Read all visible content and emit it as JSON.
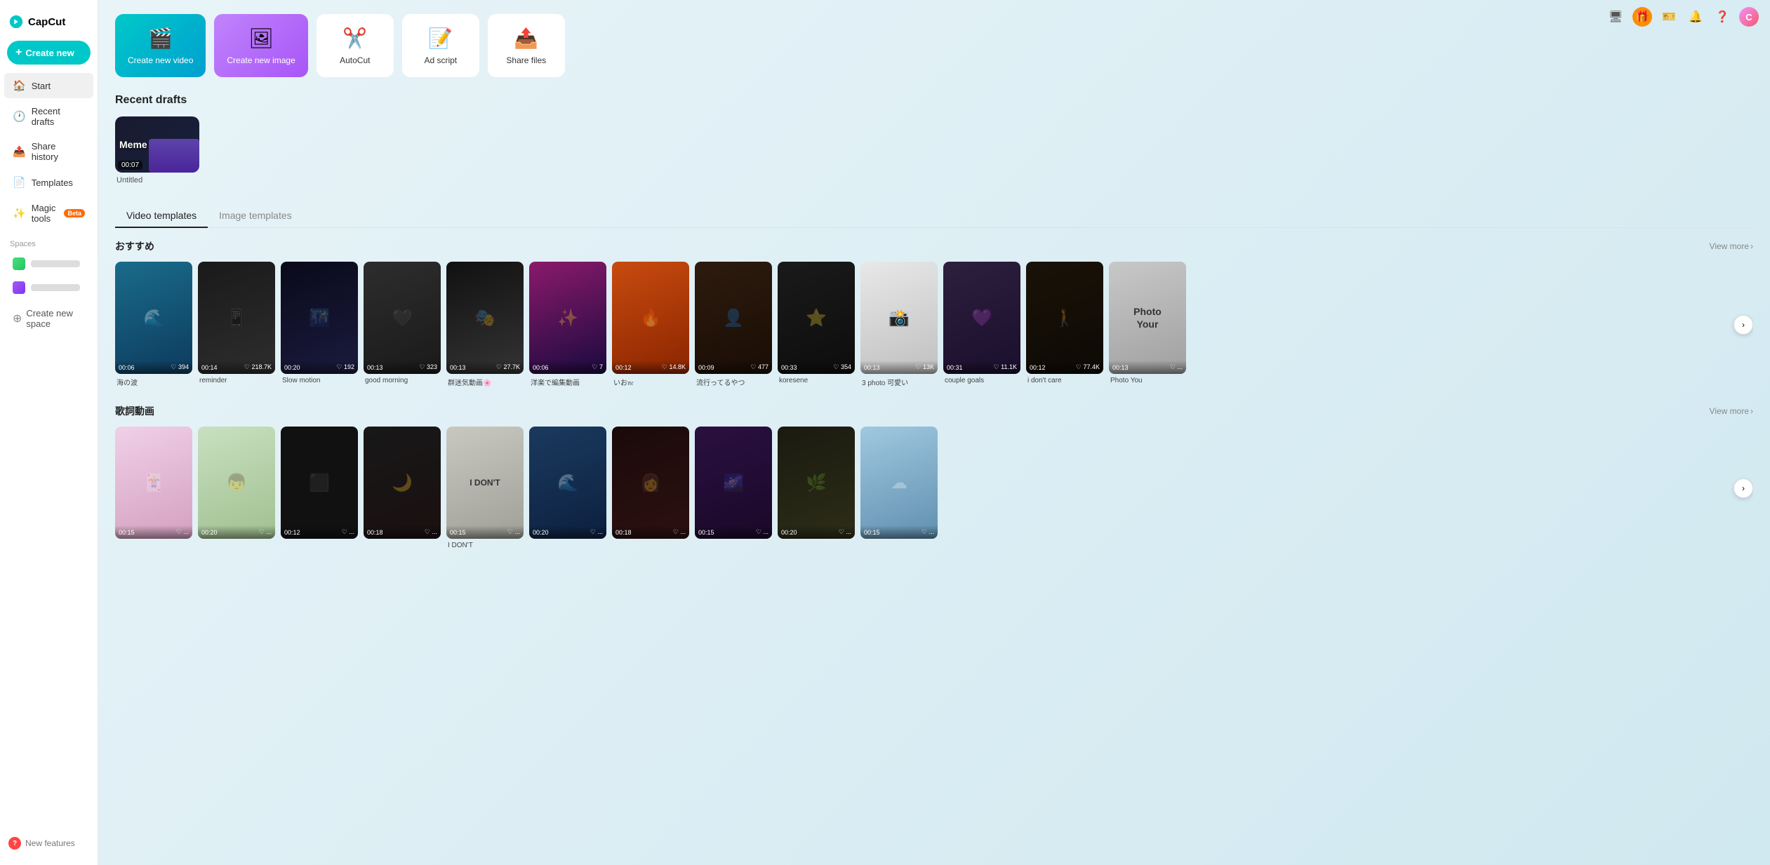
{
  "app": {
    "name": "CapCut",
    "logo_symbol": "✂"
  },
  "topbar": {
    "icons": [
      "🖥",
      "🟠",
      "🎫",
      "🔔",
      "❓"
    ],
    "user_initial": "C"
  },
  "sidebar": {
    "create_button": "+ Create new",
    "nav_items": [
      {
        "id": "start",
        "label": "Start",
        "icon": "🏠",
        "active": true
      },
      {
        "id": "recent-drafts",
        "label": "Recent drafts",
        "icon": "🕐",
        "active": false
      },
      {
        "id": "share-history",
        "label": "Share history",
        "icon": "📤",
        "active": false
      },
      {
        "id": "templates",
        "label": "Templates",
        "icon": "📄",
        "active": false
      },
      {
        "id": "magic-tools",
        "label": "Magic tools",
        "icon": "✨",
        "active": false,
        "badge": "Beta"
      }
    ],
    "spaces_label": "Spaces",
    "spaces": [
      {
        "id": "space1",
        "color1": "#4ade80",
        "color2": "#22c55e"
      },
      {
        "id": "space2",
        "color1": "#a855f7",
        "color2": "#7c3aed"
      }
    ],
    "create_new_space": "Create new space",
    "new_features": "New features",
    "new_features_count": "?"
  },
  "quick_actions": [
    {
      "id": "create-video",
      "label": "Create new video",
      "icon": "🎬",
      "style": "teal"
    },
    {
      "id": "create-image",
      "label": "Create new image",
      "icon": "🖼",
      "style": "purple"
    },
    {
      "id": "autocut",
      "label": "AutoCut",
      "icon": "✂",
      "style": "white"
    },
    {
      "id": "ad-script",
      "label": "Ad script",
      "icon": "📝",
      "style": "white"
    },
    {
      "id": "share-files",
      "label": "Share files",
      "icon": "📤",
      "style": "white"
    }
  ],
  "recent_drafts": {
    "title": "Recent drafts",
    "items": [
      {
        "id": "draft1",
        "name": "Untitled",
        "duration": "00:07",
        "thumb_label": "Meme"
      }
    ]
  },
  "template_tabs": [
    {
      "id": "video",
      "label": "Video templates",
      "active": true
    },
    {
      "id": "image",
      "label": "Image templates",
      "active": false
    }
  ],
  "template_sections": [
    {
      "id": "recommended",
      "category": "おすすめ",
      "view_more": "View more",
      "templates": [
        {
          "id": "t1",
          "name": "海の波",
          "duration": "00:06",
          "likes": "394",
          "bg": "ocean"
        },
        {
          "id": "t2",
          "name": "reminder",
          "duration": "00:14",
          "likes": "218.7K",
          "bg": "dark"
        },
        {
          "id": "t3",
          "name": "Slow motion",
          "duration": "00:20",
          "likes": "192",
          "bg": "night"
        },
        {
          "id": "t4",
          "name": "good morning",
          "duration": "00:13",
          "likes": "323",
          "bg": "collage"
        },
        {
          "id": "t5",
          "name": "群迷気動画🌸",
          "duration": "00:13",
          "likes": "27.7K",
          "bg": "mono"
        },
        {
          "id": "t6",
          "name": "洋楽で編集動画",
          "duration": "00:06",
          "likes": "7",
          "bg": "bokeh"
        },
        {
          "id": "t7",
          "name": "いお𝔫𝔢",
          "duration": "00:12",
          "likes": "14.8K",
          "bg": "warm"
        },
        {
          "id": "t8",
          "name": "流行ってるやつ",
          "duration": "00:09",
          "likes": "477",
          "bg": "portrait"
        },
        {
          "id": "t9",
          "name": "koresene",
          "duration": "00:33",
          "likes": "354",
          "bg": "fashion"
        },
        {
          "id": "t10",
          "name": "3 photo 可愛い",
          "duration": "00:13",
          "likes": "13K",
          "bg": "photo"
        },
        {
          "id": "t11",
          "name": "couple goals",
          "duration": "00:31",
          "likes": "11.1K",
          "bg": "couple"
        },
        {
          "id": "t12",
          "name": "i don't care",
          "duration": "00:12",
          "likes": "77.4K",
          "bg": "street"
        },
        {
          "id": "t13",
          "name": "Photo You 00:13",
          "duration": "00:13",
          "likes": "...",
          "bg": "photo"
        }
      ]
    },
    {
      "id": "lyrics",
      "category": "歌詞動画",
      "view_more": "View more",
      "templates": [
        {
          "id": "l1",
          "name": "",
          "duration": "00:15",
          "likes": "...",
          "bg": "cards"
        },
        {
          "id": "l2",
          "name": "",
          "duration": "00:20",
          "likes": "...",
          "bg": "boy"
        },
        {
          "id": "l3",
          "name": "",
          "duration": "00:12",
          "likes": "...",
          "bg": "black"
        },
        {
          "id": "l4",
          "name": "",
          "duration": "00:18",
          "likes": "...",
          "bg": "couple2"
        },
        {
          "id": "l5",
          "name": "I DON'T",
          "duration": "00:15",
          "likes": "...",
          "bg": "idc"
        },
        {
          "id": "l6",
          "name": "",
          "duration": "00:20",
          "likes": "...",
          "bg": "sea"
        },
        {
          "id": "l7",
          "name": "",
          "duration": "00:18",
          "likes": "...",
          "bg": "girl2"
        },
        {
          "id": "l8",
          "name": "",
          "duration": "00:15",
          "likes": "...",
          "bg": "gradient2"
        },
        {
          "id": "l9",
          "name": "",
          "duration": "00:20",
          "likes": "...",
          "bg": "girl3"
        },
        {
          "id": "l10",
          "name": "",
          "duration": "00:15",
          "likes": "...",
          "bg": "sky"
        }
      ]
    }
  ]
}
